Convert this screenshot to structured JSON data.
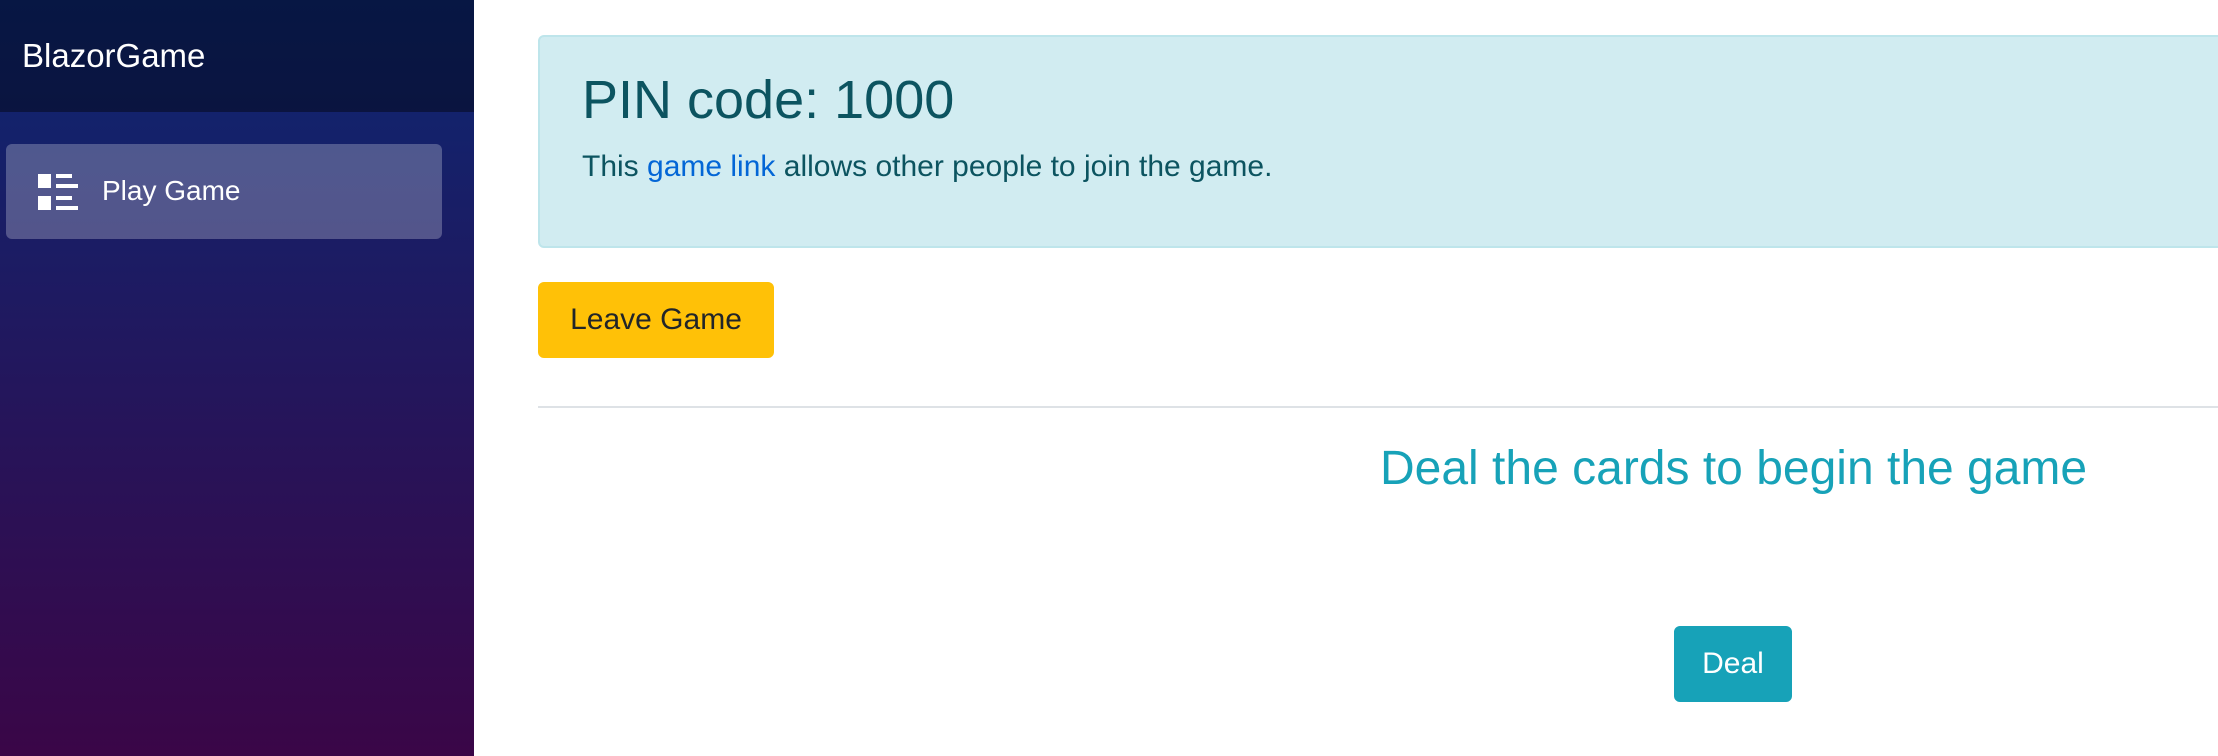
{
  "sidebar": {
    "brand": "BlazorGame",
    "items": [
      {
        "label": "Play Game",
        "icon": "list-rich-icon",
        "active": true
      }
    ]
  },
  "alert": {
    "heading": "PIN code: 1000",
    "text_before": "This ",
    "link_text": "game link",
    "text_after": " allows other people to join the game."
  },
  "actions": {
    "leave_label": "Leave Game"
  },
  "game": {
    "prompt": "Deal the cards to begin the game",
    "deal_label": "Deal"
  },
  "colors": {
    "sidebar_top": "#0c2772",
    "sidebar_bottom": "#3a0647",
    "alert_bg": "#d1ecf1",
    "alert_text": "#0c5460",
    "link": "#0366d6",
    "warning": "#ffc107",
    "info": "#17a2b8"
  }
}
